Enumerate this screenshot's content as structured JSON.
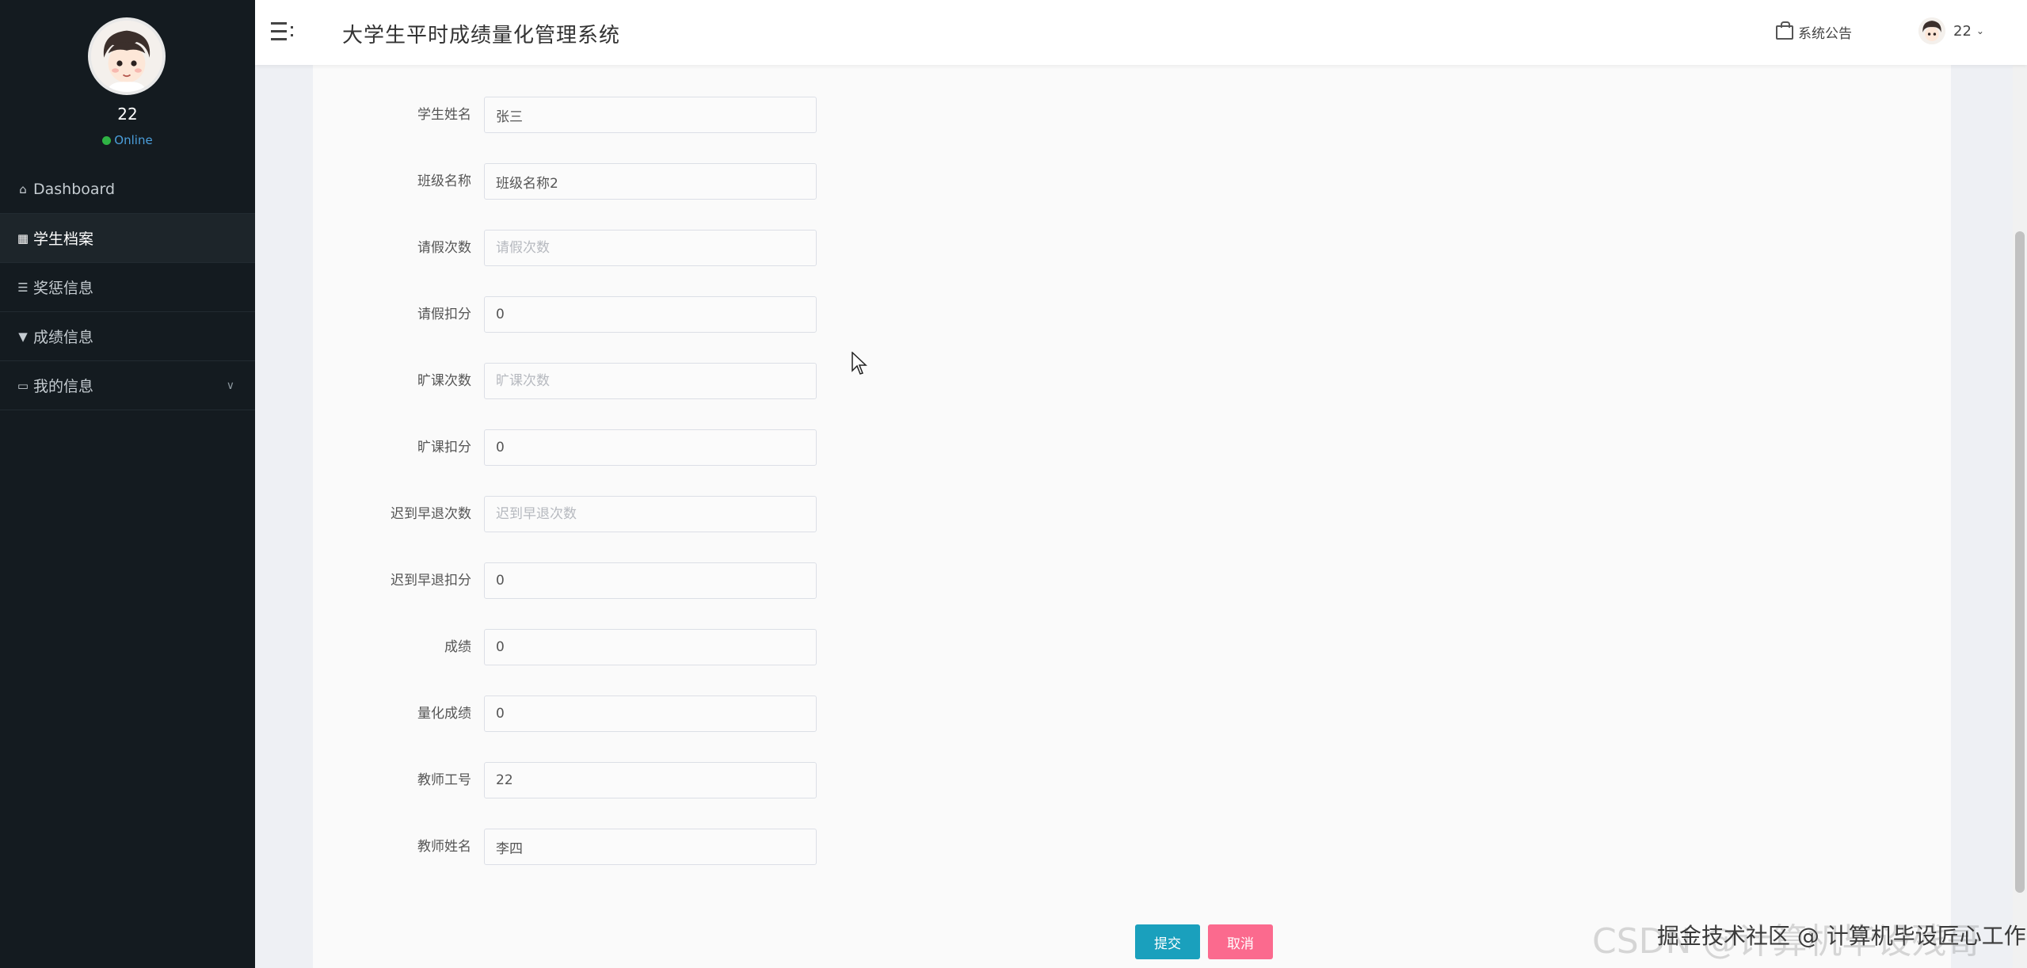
{
  "app": {
    "title": "大学生平时成绩量化管理系统"
  },
  "header": {
    "notice_label": "系统公告",
    "user_name": "22"
  },
  "sidebar": {
    "user_name": "22",
    "status": "Online",
    "items": [
      {
        "label": "Dashboard",
        "icon": "home-icon"
      },
      {
        "label": "学生档案",
        "icon": "grid-icon"
      },
      {
        "label": "奖惩信息",
        "icon": "sliders-icon"
      },
      {
        "label": "成绩信息",
        "icon": "pin-icon"
      },
      {
        "label": "我的信息",
        "icon": "card-icon"
      }
    ]
  },
  "form": {
    "student_name": {
      "label": "学生姓名",
      "value": "张三",
      "placeholder": ""
    },
    "class_name": {
      "label": "班级名称",
      "value": "班级名称2",
      "placeholder": ""
    },
    "leave_count": {
      "label": "请假次数",
      "value": "",
      "placeholder": "请假次数"
    },
    "leave_deduct": {
      "label": "请假扣分",
      "value": "0",
      "placeholder": ""
    },
    "absent_count": {
      "label": "旷课次数",
      "value": "",
      "placeholder": "旷课次数"
    },
    "absent_deduct": {
      "label": "旷课扣分",
      "value": "0",
      "placeholder": ""
    },
    "late_count": {
      "label": "迟到早退次数",
      "value": "",
      "placeholder": "迟到早退次数"
    },
    "late_deduct": {
      "label": "迟到早退扣分",
      "value": "0",
      "placeholder": ""
    },
    "score": {
      "label": "成绩",
      "value": "0",
      "placeholder": ""
    },
    "quant_score": {
      "label": "量化成绩",
      "value": "0",
      "placeholder": ""
    },
    "teacher_id": {
      "label": "教师工号",
      "value": "22",
      "placeholder": ""
    },
    "teacher_name": {
      "label": "教师姓名",
      "value": "李四",
      "placeholder": ""
    }
  },
  "buttons": {
    "submit": "提交",
    "cancel": "取消"
  },
  "watermark": {
    "back": "CSDN @计算机毕设残哥",
    "front": "掘金技术社区 @ 计算机毕设匠心工作室"
  },
  "colors": {
    "sidebar_bg": "#141b20",
    "submit_btn": "#1aa0bd",
    "cancel_btn": "#fb6a8e",
    "online_dot": "#2fb344"
  }
}
